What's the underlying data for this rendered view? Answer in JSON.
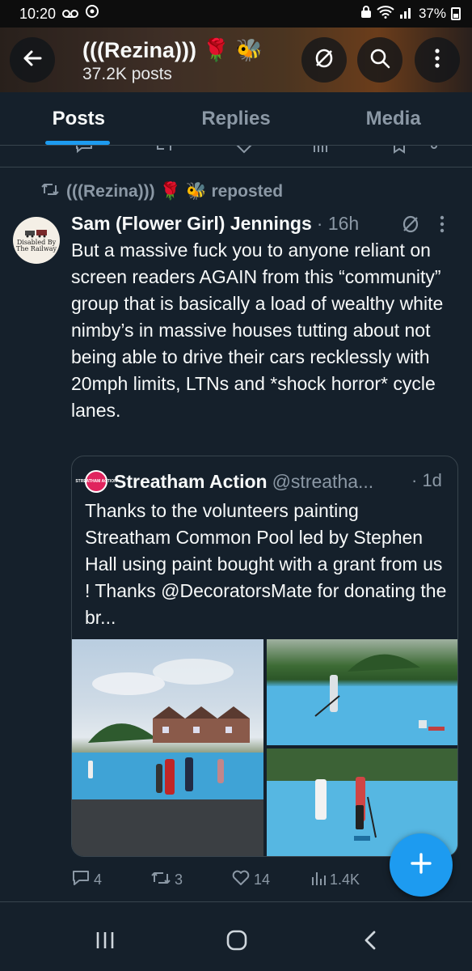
{
  "status_bar": {
    "time": "10:20",
    "battery": "37%"
  },
  "header": {
    "title": "(((Rezina))) 🌹 🐝",
    "posts_count": "37.2K posts"
  },
  "tabs": [
    {
      "label": "Posts",
      "active": true
    },
    {
      "label": "Replies",
      "active": false
    },
    {
      "label": "Media",
      "active": false
    }
  ],
  "repost": {
    "text": "(((Rezina))) 🌹 🐝 reposted"
  },
  "tweet": {
    "author_name": "Sam (Flower Girl) Jennings",
    "time": "· 16h",
    "avatar_text": "Disabled By The Railway",
    "body": "But a massive fuck you to anyone reliant on screen readers AGAIN from this “community” group that is basically a load of wealthy white nimby’s in massive houses tutting about not being able to drive their cars recklessly with 20mph limits, LTNs and *shock horror* cycle lanes.",
    "quote": {
      "avatar_text": "STREATHAM ACTION",
      "name": "Streatham Action",
      "handle": "@streatha...",
      "time": "· 1d",
      "text": "Thanks to the volunteers painting Streatham Common Pool led by Stephen Hall using paint bought with a grant from us ! Thanks @DecoratorsMate for donating the br..."
    },
    "stats": {
      "replies": "4",
      "reposts": "3",
      "likes": "14",
      "views": "1.4K"
    }
  },
  "fab": {
    "label": "+"
  },
  "colors": {
    "background": "#15202b",
    "accent": "#1d9bf0",
    "secondary_text": "#8b98a5",
    "divider": "#38444d"
  },
  "icons": {
    "back": "arrow-left-icon",
    "mute": "mute-circle-icon",
    "search": "search-icon",
    "more": "more-vertical-icon",
    "repost": "repost-icon",
    "reply": "reply-icon",
    "like": "heart-icon",
    "views": "views-chart-icon",
    "compose": "plus-icon"
  }
}
